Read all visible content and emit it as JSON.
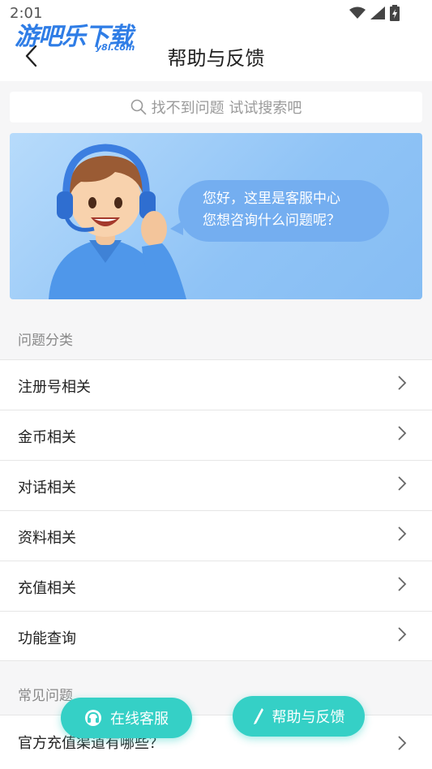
{
  "status_bar": {
    "time": "2:01"
  },
  "watermark": {
    "main": "游吧乐下载",
    "sub": "y8l.com"
  },
  "header": {
    "title": "帮助与反馈"
  },
  "search": {
    "placeholder": "找不到问题 试试搜索吧"
  },
  "banner": {
    "line1": "您好，这里是客服中心",
    "line2": "您想咨询什么问题呢？"
  },
  "categories": {
    "heading": "问题分类",
    "items": [
      {
        "label": "注册号相关"
      },
      {
        "label": "金币相关"
      },
      {
        "label": "对话相关"
      },
      {
        "label": "资料相关"
      },
      {
        "label": "充值相关"
      },
      {
        "label": "功能查询"
      }
    ]
  },
  "faq": {
    "heading": "常见问题",
    "items": [
      {
        "label": "官方充值渠道有哪些？"
      }
    ]
  },
  "actions": {
    "online_service": "在线客服",
    "help_feedback": "帮助与反馈"
  },
  "colors": {
    "accent": "#35d0c6",
    "banner_bubble": "#74aef0",
    "watermark": "#2f7de6"
  }
}
